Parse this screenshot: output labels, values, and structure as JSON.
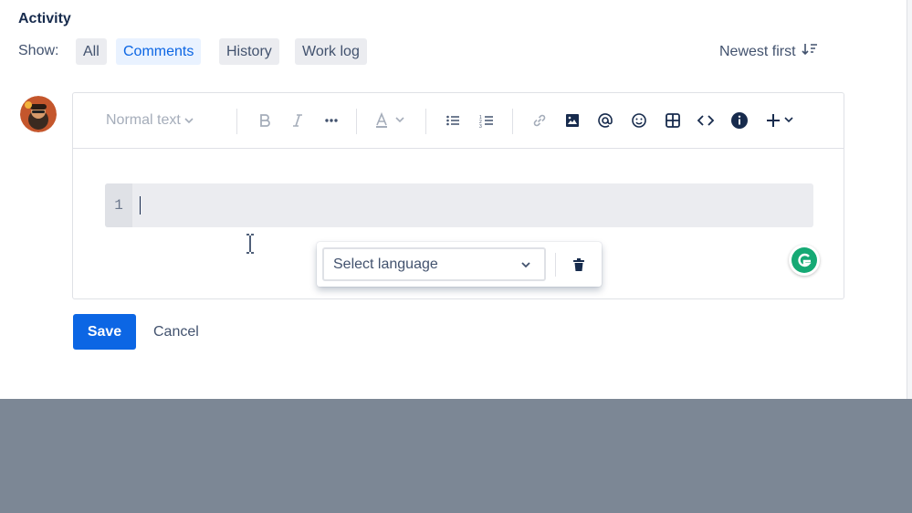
{
  "activity": {
    "title": "Activity",
    "show_label": "Show:",
    "filters": [
      {
        "label": "All",
        "active": false
      },
      {
        "label": "Comments",
        "active": true
      },
      {
        "label": "History",
        "active": false
      },
      {
        "label": "Work log",
        "active": false
      }
    ],
    "sort_label": "Newest first"
  },
  "editor": {
    "toolbar": {
      "text_style": "Normal text",
      "icons": [
        "bold-icon",
        "italic-icon",
        "more-formatting-icon",
        "text-color-icon",
        "bullet-list-icon",
        "numbered-list-icon",
        "link-icon",
        "image-icon",
        "mention-icon",
        "emoji-icon",
        "table-icon",
        "code-icon",
        "info-icon",
        "insert-plus-icon"
      ]
    },
    "code_block": {
      "line_number": "1"
    },
    "language_popup": {
      "placeholder": "Select language"
    }
  },
  "actions": {
    "save": "Save",
    "cancel": "Cancel"
  },
  "colors": {
    "primary": "#0c66e4",
    "active_filter_bg": "#e9f2ff",
    "grammarly": "#15a974",
    "backdrop": "#7c8795"
  }
}
